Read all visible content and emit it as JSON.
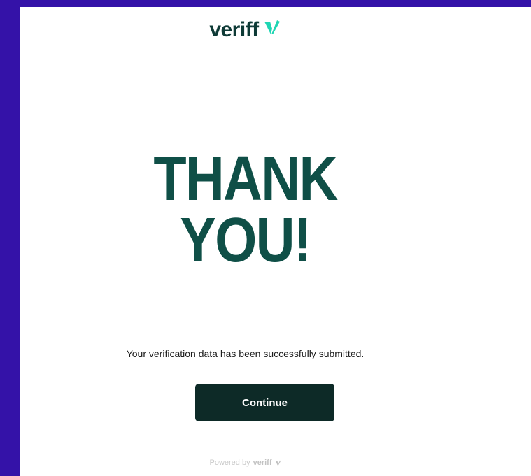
{
  "brand": {
    "name": "veriff",
    "accent_teal": "#1fd5b3",
    "accent_dark": "#0f4f47",
    "logo_icon": "veriff-check-mark-icon"
  },
  "page": {
    "headline_line1": "THANK",
    "headline_line2": "YOU!",
    "message": "Your verification data has been successfully submitted."
  },
  "actions": {
    "continue_label": "Continue"
  },
  "footer": {
    "powered_by": "Powered by",
    "brand": "veriff"
  },
  "colors": {
    "background": "#3412a8",
    "card": "#ffffff",
    "button": "#0d2a27"
  }
}
